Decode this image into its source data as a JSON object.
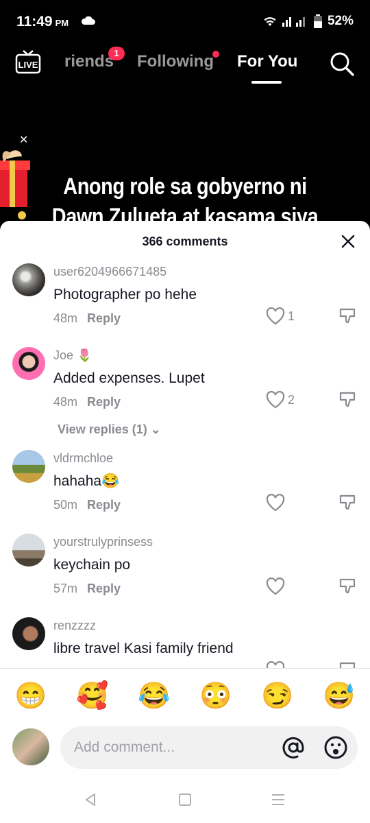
{
  "status_bar": {
    "time": "11:49",
    "ampm": "PM",
    "battery": "52%"
  },
  "nav": {
    "tabs": [
      {
        "label": "riends"
      },
      {
        "label": "Following"
      },
      {
        "label": "For You"
      }
    ],
    "friends_badge": "1",
    "live_label": "LIVE"
  },
  "video": {
    "caption_line1": "Anong role sa gobyerno ni",
    "caption_line2": "Dawn Zulueta at kasama siya"
  },
  "comments": {
    "count_label": "366 comments",
    "reply_label": "Reply",
    "items": [
      {
        "username": "user6204966671485",
        "text": "Photographer po hehe",
        "time": "48m",
        "likes": "1"
      },
      {
        "username": "Joe 🌷",
        "text": "Added expenses. Lupet",
        "time": "48m",
        "likes": "2",
        "view_replies": "View replies (1)"
      },
      {
        "username": "vldrmchloe",
        "text": "hahaha😂",
        "time": "50m",
        "likes": ""
      },
      {
        "username": "yourstrulyprinsess",
        "text": "keychain po",
        "time": "57m",
        "likes": ""
      },
      {
        "username": "renzzzz",
        "text": "libre travel Kasi family friend",
        "time": "",
        "likes": ""
      }
    ]
  },
  "emojis": [
    "😁",
    "🥰",
    "😂",
    "😳",
    "😏",
    "😅"
  ],
  "input": {
    "placeholder": "Add comment..."
  }
}
